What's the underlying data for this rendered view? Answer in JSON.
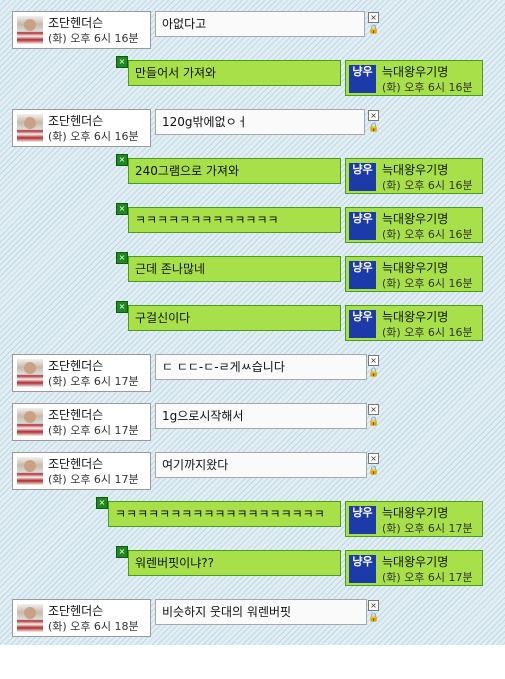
{
  "users": {
    "left": {
      "name": "조단헨더슨",
      "avatar_icon": "soccer-player-avatar"
    },
    "right": {
      "name": "늑대왕우기명",
      "avatar_icon": "blue-badge-avatar",
      "avatar_text": "냥우"
    }
  },
  "colors": {
    "left_bubble_bg": "#fafafa",
    "right_bubble_bg": "#a8e04a",
    "right_bubble_border": "#4a9c1e",
    "right_avatar_bg": "#1c3ba8"
  },
  "messages": [
    {
      "sender": "left",
      "text": "아없다고",
      "time": "(화) 오후 6시 16분"
    },
    {
      "sender": "right",
      "text": "만들어서 가져와",
      "time": "(화) 오후 6시 16분"
    },
    {
      "sender": "left",
      "text": "120g밖에없ㅇㅓ",
      "time": "(화) 오후 6시 16분"
    },
    {
      "sender": "right",
      "text": "240그램으로 가져와",
      "time": "(화) 오후 6시 16분"
    },
    {
      "sender": "right",
      "text": "ㅋㅋㅋㅋㅋㅋㅋㅋㅋㅋㅋㅋㅋ",
      "time": "(화) 오후 6시 16분"
    },
    {
      "sender": "right",
      "text": "근데 존나많네",
      "time": "(화) 오후 6시 16분"
    },
    {
      "sender": "right",
      "text": "구걸신이다",
      "time": "(화) 오후 6시 16분"
    },
    {
      "sender": "left",
      "text": "ㄷ ㄷㄷ-ㄷ-ㄹ게ㅆ습니다",
      "time": "(화) 오후 6시 17분"
    },
    {
      "sender": "left",
      "text": "1g으로시작해서",
      "time": "(화) 오후 6시 17분"
    },
    {
      "sender": "left",
      "text": "여기까지왔다",
      "time": "(화) 오후 6시 17분"
    },
    {
      "sender": "right",
      "text": "ㅋㅋㅋㅋㅋㅋㅋㅋㅋㅋㅋㅋㅋㅋㅋㅋㅋㅋㅋ",
      "time": "(화) 오후 6시 17분"
    },
    {
      "sender": "right",
      "text": "워렌버핏이냐??",
      "time": "(화) 오후 6시 17분"
    },
    {
      "sender": "left",
      "text": "비슷하지 웃대의 워렌버핏",
      "time": "(화) 오후 6시 18분"
    }
  ]
}
